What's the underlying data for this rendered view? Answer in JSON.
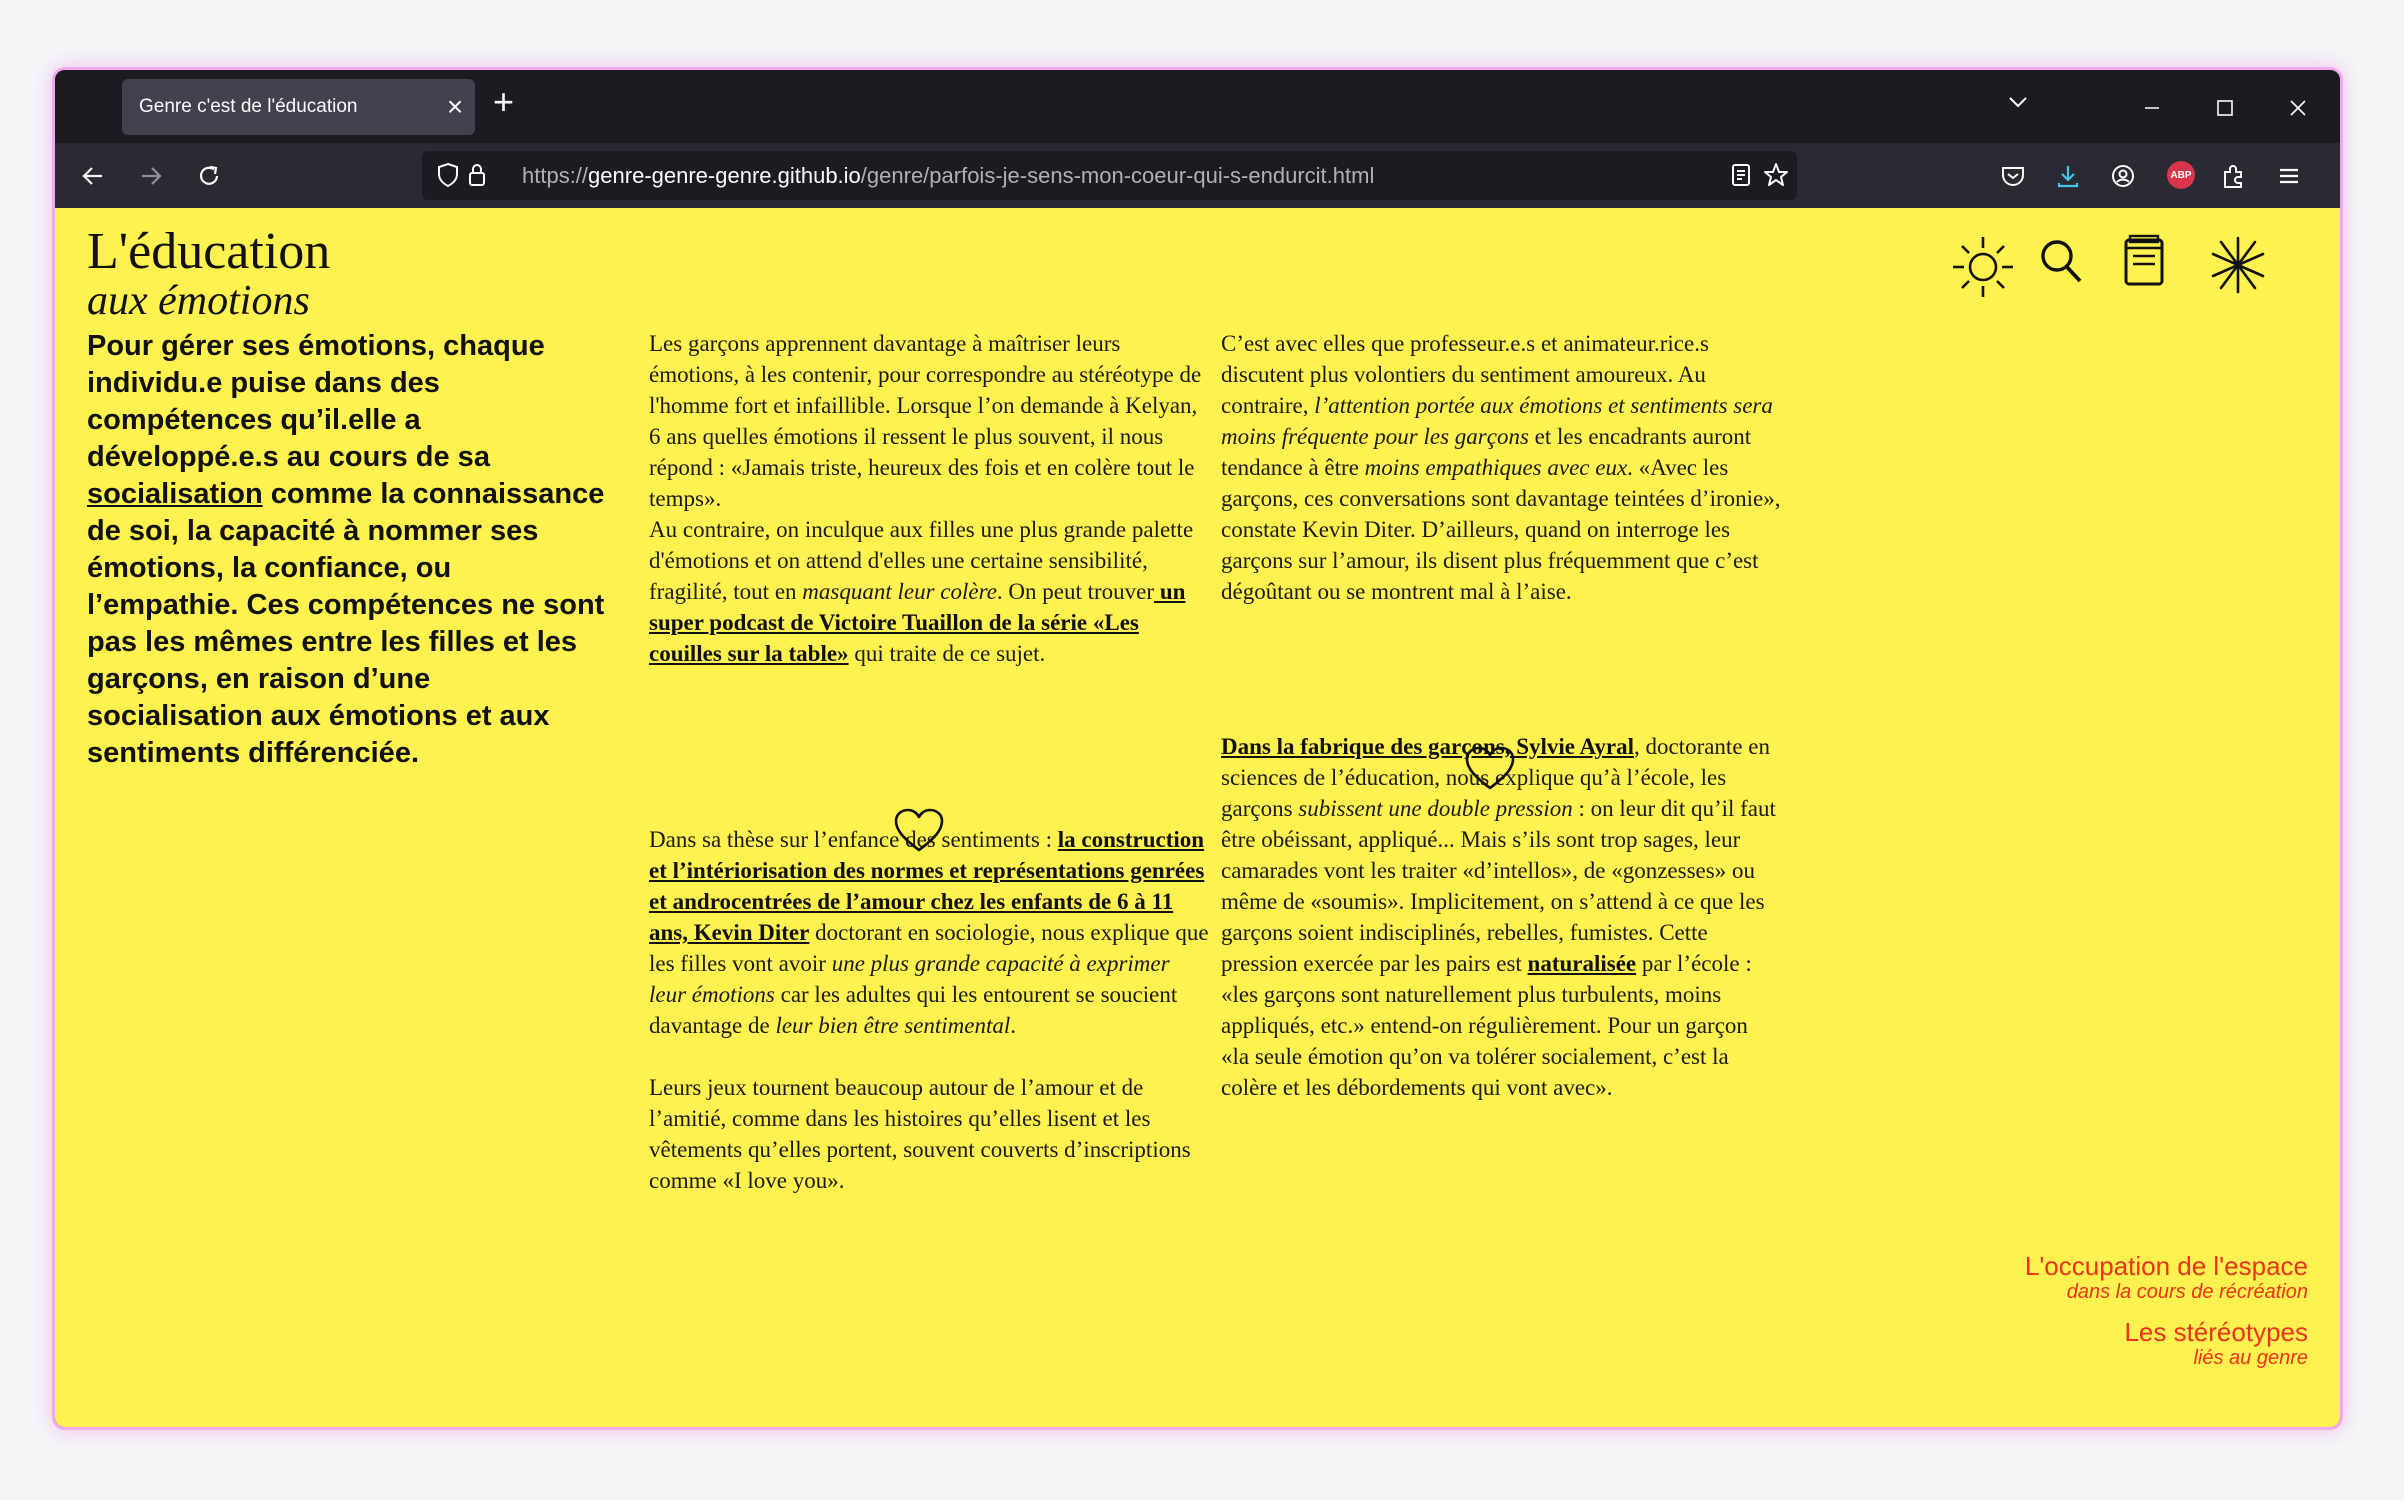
{
  "browser": {
    "tab_title": "Genre c'est de l'éducation",
    "url_host_prefix": "https://",
    "url_host": "genre-genre-genre.github.io",
    "url_path": "/genre/parfois-je-sens-mon-coeur-qui-s-endurcit.html",
    "abp_label": "ABP"
  },
  "site": {
    "title_line1": "L'éducation",
    "title_line2": "aux émotions"
  },
  "intro": {
    "part1": "Pour gérer ses émotions, chaque individu.e puise dans des compétences qu’il.elle a développé.e.s au cours de sa ",
    "link": "socialisation",
    "part2": " comme la connaissance de soi, la capacité à nommer ses émotions, la confiance, ou l’empathie. Ces compétences ne sont pas les mêmes entre les filles et les garçons, en raison d’une socialisation aux émotions et aux sentiments différenciée."
  },
  "col1": {
    "p1": "Les garçons apprennent davantage à maîtriser leurs émotions, à les contenir, pour correspondre au stéréotype de l'homme fort et infaillible. Lorsque l’on demande à Kelyan, 6 ans quelles émotions il ressent le plus souvent, il nous répond : «Jamais triste, heureux des fois et en colère tout le temps».",
    "p2a": "Au contraire, on inculque aux filles une plus grande palette d'émotions et on attend d'elles une certaine sensibilité, fragilité, tout en ",
    "p2_em": "masquant leur colère",
    "p2b": ". On peut trouver",
    "p2_link": " un super podcast de Victoire Tuaillon de la série «Les couilles sur la table»",
    "p2c": " qui traite de ce sujet.",
    "p3a": "Dans sa thèse sur l’enfance des sentiments : ",
    "p3_link": "la construction et l’intériorisation des normes et représentations genrées et androcentrées de l’amour chez les enfants de 6 à 11 ans, Kevin Diter",
    "p3b": " doctorant en sociologie, nous explique que les filles vont avoir ",
    "p3_em1": "une plus grande capacité à exprimer leur émotions",
    "p3c": " car les adultes qui les entourent se soucient davantage de ",
    "p3_em2": "leur bien être sentimental",
    "p3d": ".",
    "p4": "Leurs jeux tournent beaucoup autour de l’amour et de l’amitié, comme dans les histoires qu’elles lisent et les vêtements qu’elles portent, souvent couverts d’inscriptions comme «I love you»."
  },
  "col2": {
    "p1a": "C’est avec elles que professeur.e.s et animateur.rice.s discutent plus volontiers du sentiment amoureux. Au contraire, ",
    "p1_em1": "l’attention portée aux émotions et sentiments sera moins fréquente pour les garçons",
    "p1b": " et les encadrants auront tendance à être ",
    "p1_em2": "moins empathiques avec eux",
    "p1c": ". «Avec les garçons, ces conversations sont davantage teintées d’ironie», constate Kevin Diter. D’ailleurs, quand on interroge les garçons sur l’amour, ils disent plus fréquemment que c’est dégoûtant ou se montrent mal à l’aise.",
    "p2_link": "Dans la fabrique des garçons, Sylvie Ayral",
    "p2a": ", doctorante en sciences de l’éducation, nous explique qu’à l’école, les garçons ",
    "p2_em1": "subissent une double pression",
    "p2b": " : on leur dit qu’il faut être obéissant, appliqué... Mais s’ils sont trop sages, leur camarades vont les traiter «d’intellos», de «gonzesses» ou même de «soumis». Implicitement, on s’attend à ce que les garçons soient indisciplinés, rebelles, fumistes. Cette pression exercée par les pairs est ",
    "p2_link2": "naturalisée",
    "p2c": " par l’école : «les garçons sont naturellement plus turbulents, moins appliqués, etc.» entend-on régulièrement. Pour un garçon «la seule émotion qu’on va tolérer socialement, c’est la colère et les débordements qui vont avec»."
  },
  "links": {
    "l1_main": "L'occupation de l'espace",
    "l1_sub": "dans la cours de récréation",
    "l2_main": "Les stéréotypes",
    "l2_sub": "liés au genre"
  },
  "icons": [
    "sun-icon",
    "search-icon",
    "book-icon",
    "asterisk-icon",
    "heart-icon"
  ],
  "colors": {
    "page_bg": "#fff250",
    "link_red": "#e8341c",
    "browser_dark": "#1c1b22"
  }
}
